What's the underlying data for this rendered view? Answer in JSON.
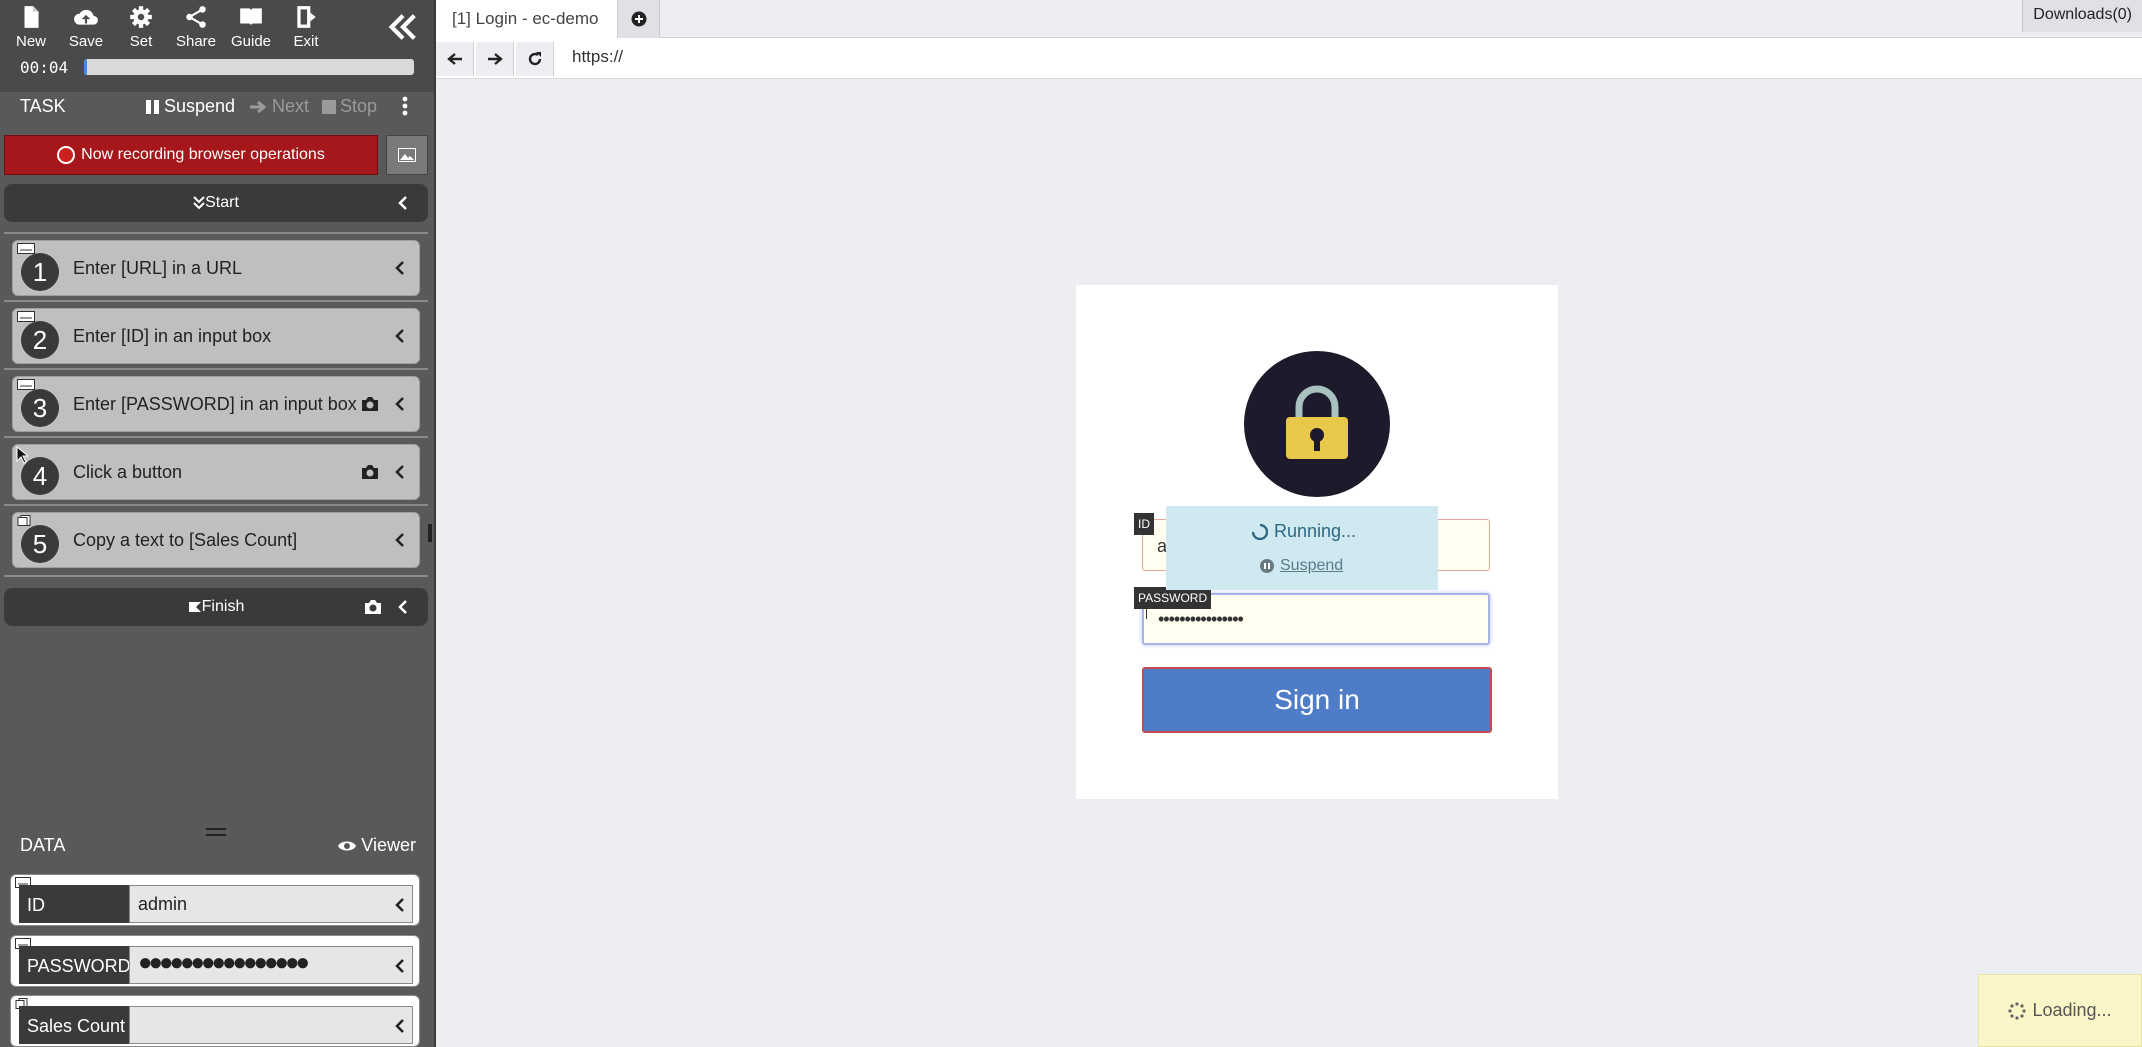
{
  "toolbar": {
    "buttons": [
      {
        "label": "New",
        "icon": "file-icon"
      },
      {
        "label": "Save",
        "icon": "cloud-upload-icon"
      },
      {
        "label": "Set",
        "icon": "gear-icon"
      },
      {
        "label": "Share",
        "icon": "share-icon"
      },
      {
        "label": "Guide",
        "icon": "book-icon"
      },
      {
        "label": "Exit",
        "icon": "exit-door-icon"
      }
    ],
    "timer": "00:04",
    "progress_fraction": 0.01
  },
  "task": {
    "title": "TASK",
    "suspend_label": "Suspend",
    "next_label": "Next",
    "stop_label": "Stop",
    "recording_text": "Now recording browser operations",
    "start_label": "Start",
    "finish_label": "Finish",
    "steps": [
      {
        "num": "1",
        "label": "Enter [URL] in a URL",
        "icon": "keyboard-icon"
      },
      {
        "num": "2",
        "label": "Enter [ID] in an input box",
        "icon": "keyboard-icon"
      },
      {
        "num": "3",
        "label": "Enter [PASSWORD] in an input box",
        "icon": "keyboard-icon"
      },
      {
        "num": "4",
        "label": "Click a button",
        "icon": "mouse-icon"
      },
      {
        "num": "5",
        "label": "Copy a text to [Sales Count]",
        "icon": "copy-icon"
      }
    ]
  },
  "data_panel": {
    "title": "DATA",
    "viewer_label": "Viewer",
    "rows": [
      {
        "name": "ID",
        "value": "admin"
      },
      {
        "name": "PASSWORD",
        "value": "●●●●●●●●●●●●●●●●"
      },
      {
        "name": "Sales Count",
        "value": ""
      }
    ]
  },
  "browser": {
    "tab_title": "[1] Login - ec-demo",
    "downloads_label": "Downloads(0)",
    "url": "https://"
  },
  "login_page": {
    "id_tag": "ID",
    "id_value": "a",
    "password_tag": "PASSWORD",
    "password_value": "••••••••••••••••",
    "signin_label": "Sign in"
  },
  "overlay": {
    "running_text": "Running...",
    "suspend_link": "Suspend"
  },
  "toast": {
    "loading_text": "Loading..."
  },
  "colors": {
    "recording_red": "#a5171a",
    "signin_blue": "#4e7cc6",
    "sidebar_bg": "#595959"
  }
}
